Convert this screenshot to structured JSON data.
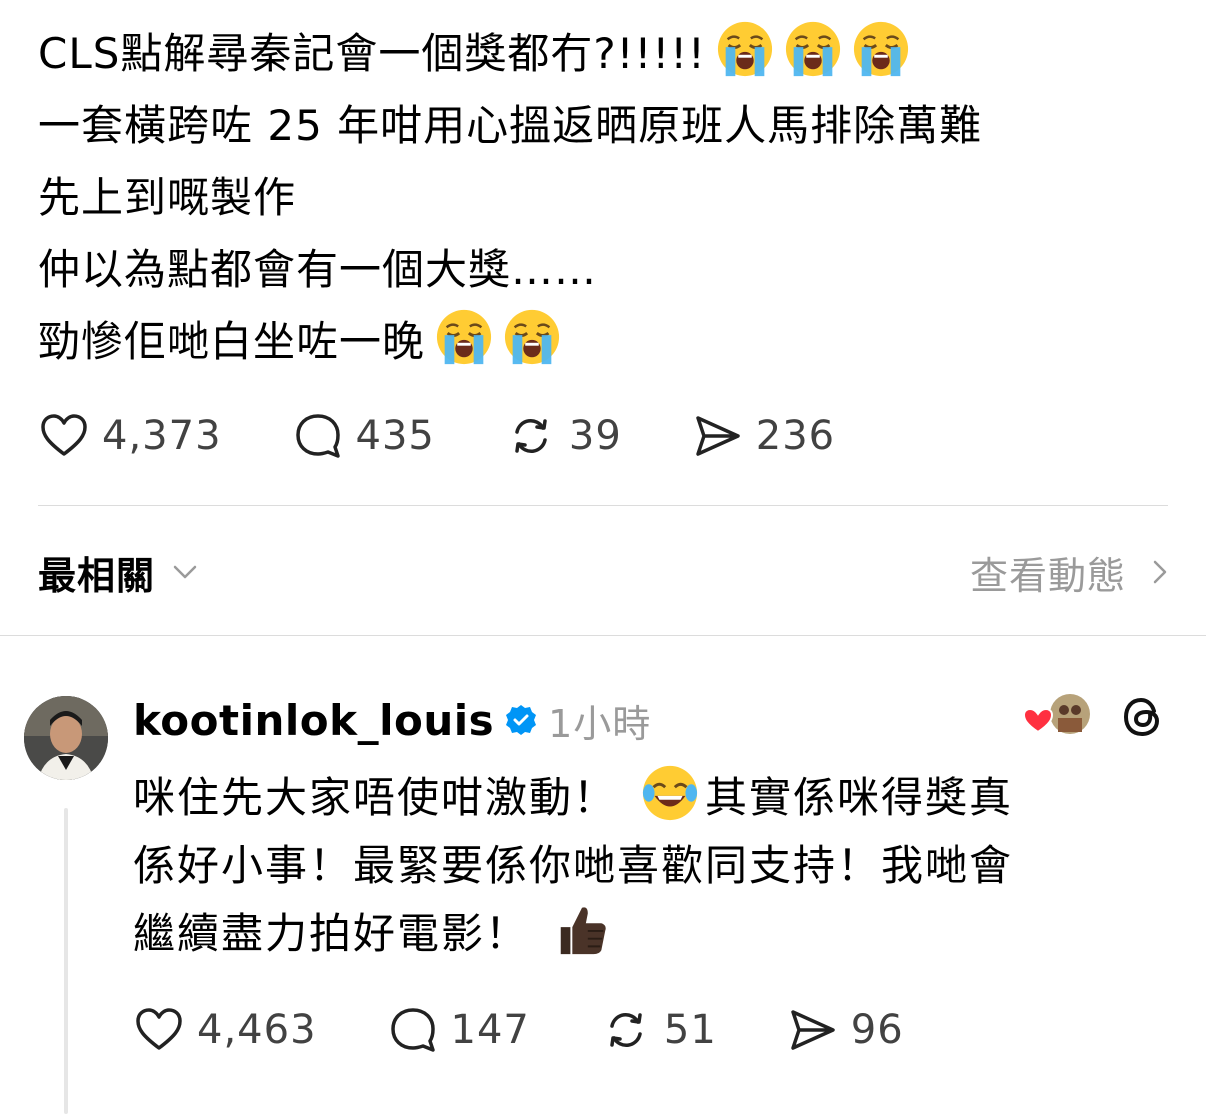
{
  "post": {
    "lines": [
      "CLS點解尋秦記會一個獎都冇?!!!!!",
      "一套橫跨咗 25 年咁用心搵返晒原班人馬排除萬難",
      "先上到嘅製作",
      "仲以為點都會有一個大獎……",
      "勁慘佢哋白坐咗一晚"
    ],
    "line1_emoji": "loudly-crying-face",
    "line5_emoji": "loudly-crying-face",
    "stats": {
      "likes": "4,373",
      "comments": "435",
      "reposts": "39",
      "shares": "236"
    }
  },
  "sort": {
    "label": "最相關",
    "activity_label": "查看動態"
  },
  "reply": {
    "username": "kootinlok_louis",
    "time": "1小時",
    "lines": [
      "咪住先大家唔使咁激動！",
      "其實係咪得獎真",
      "係好小事！最緊要係你哋喜歡同支持！我哋會",
      "繼續盡力拍好電影！"
    ],
    "emojis": [
      "face-with-tears-of-joy",
      "thumbs-up-dark-skin"
    ],
    "stats": {
      "likes": "4,463",
      "comments": "147",
      "reposts": "51",
      "shares": "96"
    }
  },
  "colors": {
    "text": "#000000",
    "secondary": "#9a9a9a",
    "stat_text": "#424242",
    "verified": "#0095f6",
    "divider": "#dcdcdc",
    "heart": "#ff3040"
  }
}
